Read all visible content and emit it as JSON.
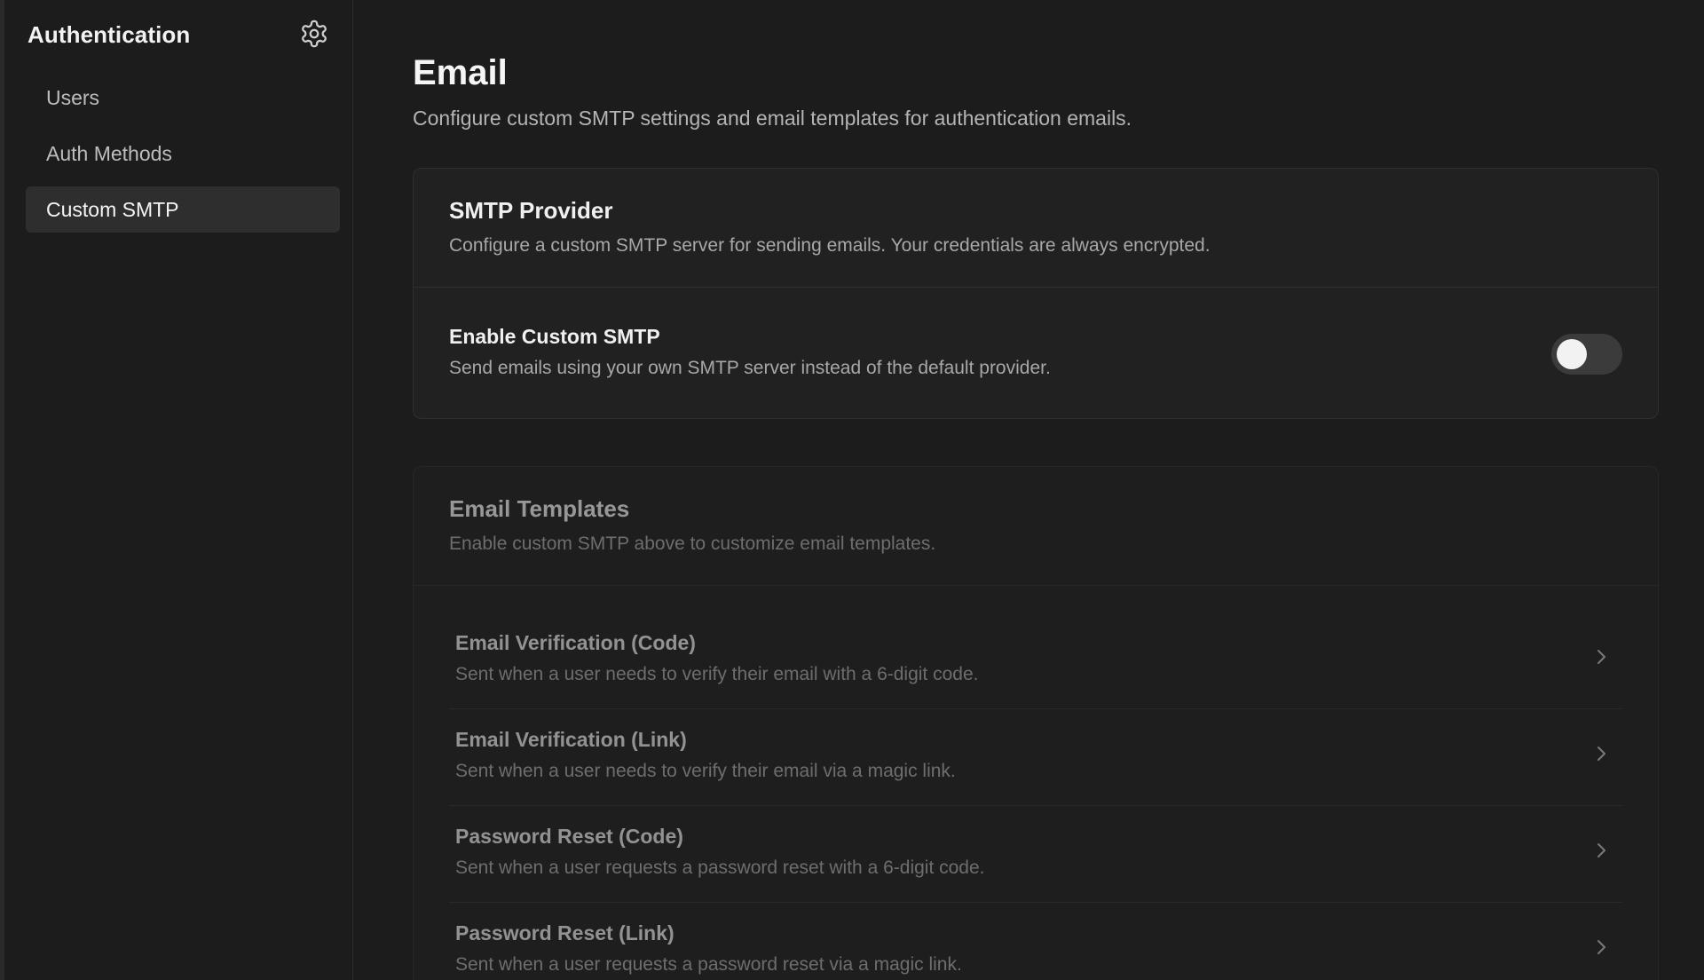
{
  "sidebar": {
    "title": "Authentication",
    "settings_icon": "gear-icon",
    "items": [
      {
        "label": "Users",
        "active": false
      },
      {
        "label": "Auth Methods",
        "active": false
      },
      {
        "label": "Custom SMTP",
        "active": true
      }
    ]
  },
  "page": {
    "title": "Email",
    "description": "Configure custom SMTP settings and email templates for authentication emails."
  },
  "smtp_provider": {
    "title": "SMTP Provider",
    "description": "Configure a custom SMTP server for sending emails. Your credentials are always encrypted.",
    "toggle": {
      "label": "Enable Custom SMTP",
      "description": "Send emails using your own SMTP server instead of the default provider.",
      "enabled": false
    }
  },
  "email_templates": {
    "title": "Email Templates",
    "description": "Enable custom SMTP above to customize email templates.",
    "items": [
      {
        "title": "Email Verification (Code)",
        "description": "Sent when a user needs to verify their email with a 6-digit code."
      },
      {
        "title": "Email Verification (Link)",
        "description": "Sent when a user needs to verify their email via a magic link."
      },
      {
        "title": "Password Reset (Code)",
        "description": "Sent when a user requests a password reset with a 6-digit code."
      },
      {
        "title": "Password Reset (Link)",
        "description": "Sent when a user requests a password reset via a magic link."
      }
    ]
  },
  "colors": {
    "background": "#1c1c1c",
    "card": "#212121",
    "active_nav": "#2e2e2e",
    "text_primary": "#f0f0f0",
    "text_secondary": "#a8a8a8"
  }
}
